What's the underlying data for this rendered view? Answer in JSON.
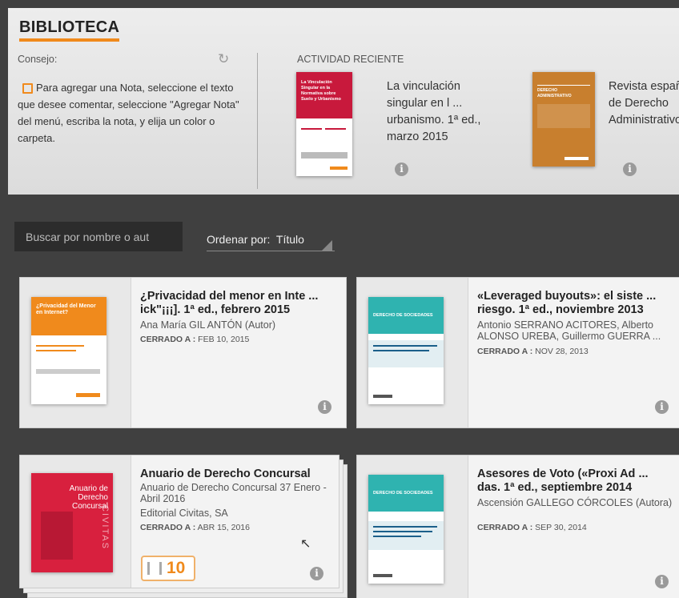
{
  "header": {
    "title": "BIBLIOTECA",
    "tip_label": "Consejo:",
    "tip_text": "Para agregar una Nota, seleccione el texto que desee comentar, seleccione \"Agregar Nota\" del menú, escriba la nota, y elija un color o carpeta.",
    "recent_label": "ACTIVIDAD RECIENTE",
    "recent": [
      {
        "title": "La vinculación singular en l ... urbanismo. 1ª ed., marzo 2015",
        "cover_text": "La Vinculación Singular en la Normativa sobre Suelo y Urbanismo"
      },
      {
        "title": "Revista española de Derecho Administrativo",
        "cover_text": "DERECHO ADMINISTRATIVO"
      }
    ]
  },
  "controls": {
    "search_placeholder": "Buscar por nombre o aut",
    "sort_label": "Ordenar por:",
    "sort_value": "Título"
  },
  "books": [
    {
      "title": "¿Privacidad del menor en Inte ... ick\"¡¡¡]. 1ª ed., febrero 2015",
      "author": "Ana María GIL ANTÓN (Autor)",
      "closed_label": "CERRADO A :",
      "closed_date": "FEB 10, 2015",
      "cover_title": "¿Privacidad del Menor en Internet?"
    },
    {
      "title": "«Leveraged buyouts»: el siste ... riesgo. 1ª ed., noviembre 2013",
      "author": "Antonio SERRANO ACITORES, Alberto ALONSO UREBA, Guillermo GUERRA ...",
      "closed_label": "CERRADO A :",
      "closed_date": "NOV 28, 2013",
      "cover_title": "DERECHO DE SOCIEDADES"
    },
    {
      "title": "Anuario de Derecho Concursal",
      "author": "Anuario de Derecho Concursal 37 Enero - Abril 2016",
      "publisher": "Editorial Civitas, SA",
      "closed_label": "CERRADO A :",
      "closed_date": "ABR 15, 2016",
      "count": "10",
      "cover_title": "Anuario de Derecho Concursal",
      "cover_side": "CIVITAS"
    },
    {
      "title": "Asesores de Voto («Proxi Ad ... das. 1ª ed., septiembre 2014",
      "author": "Ascensión GALLEGO CÓRCOLES (Autora)",
      "closed_label": "CERRADO A :",
      "closed_date": "SEP 30, 2014",
      "cover_title": "DERECHO DE SOCIEDADES"
    }
  ],
  "colors": {
    "accent": "#f08a1c",
    "card_bg": "#f3f3f3",
    "dark_bg": "#404040"
  }
}
